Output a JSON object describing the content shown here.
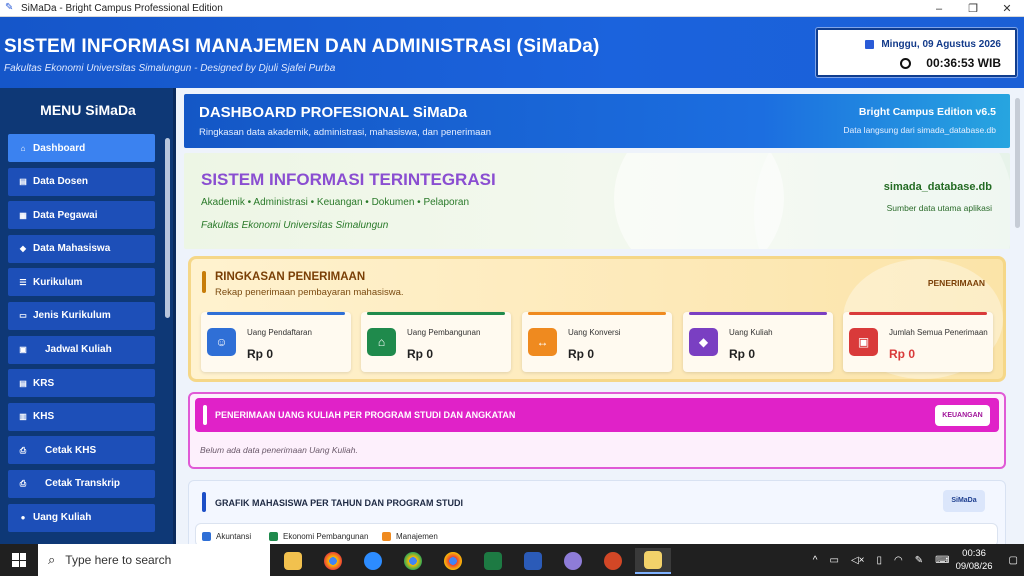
{
  "window": {
    "title": "SiMaDa - Bright Campus Professional Edition",
    "minimize": "–",
    "maximize": "❐",
    "close": "✕"
  },
  "header": {
    "title": "SISTEM INFORMASI MANAJEMEN DAN ADMINISTRASI (SiMaDa)",
    "subtitle": "Fakultas Ekonomi Universitas Simalungun - Designed by Djuli Sjafei Purba",
    "date": "Minggu, 09 Agustus 2026",
    "time": "00:36:53 WIB"
  },
  "sidebar": {
    "title": "MENU SiMaDa",
    "items": [
      {
        "label": "Dashboard",
        "icon": "home-icon",
        "glyph": "⌂"
      },
      {
        "label": "Data Dosen",
        "icon": "book-icon",
        "glyph": "▤"
      },
      {
        "label": "Data Pegawai",
        "icon": "building-icon",
        "glyph": "▦"
      },
      {
        "label": "Data Mahasiswa",
        "icon": "graduation-cap-icon",
        "glyph": "◆"
      },
      {
        "label": "Kurikulum",
        "icon": "list-icon",
        "glyph": "☰"
      },
      {
        "label": "Jenis Kurikulum",
        "icon": "folder-icon",
        "glyph": "▭"
      },
      {
        "label": "Jadwal Kuliah",
        "icon": "calendar-icon",
        "glyph": "▣"
      },
      {
        "label": "KRS",
        "icon": "clipboard-icon",
        "glyph": "▤"
      },
      {
        "label": "KHS",
        "icon": "document-icon",
        "glyph": "▥"
      },
      {
        "label": "Cetak KHS",
        "icon": "printer-icon",
        "glyph": "⎙"
      },
      {
        "label": "Cetak Transkrip",
        "icon": "printer-icon",
        "glyph": "⎙"
      },
      {
        "label": "Uang Kuliah",
        "icon": "money-icon",
        "glyph": "●"
      }
    ]
  },
  "dashboard": {
    "title": "DASHBOARD PROFESIONAL SiMaDa",
    "subtitle": "Ringkasan data akademik, administrasi, mahasiswa, dan penerimaan",
    "edition": "Bright Campus Edition v6.5",
    "source": "Data langsung dari simada_database.db"
  },
  "integrated": {
    "title": "SISTEM INFORMASI TERINTEGRASI",
    "modules": "Akademik • Administrasi • Keuangan • Dokumen • Pelaporan",
    "faculty": "Fakultas Ekonomi Universitas Simalungun",
    "db_name": "simada_database.db",
    "db_caption": "Sumber data utama aplikasi"
  },
  "receipts": {
    "title": "RINGKASAN PENERIMAAN",
    "subtitle": "Rekap penerimaan pembayaran mahasiswa.",
    "tag": "PENERIMAAN",
    "cards": [
      {
        "label": "Uang Pendaftaran",
        "value": "Rp 0",
        "color": "#2f6fd6",
        "icon": "user-icon",
        "glyph": "☺"
      },
      {
        "label": "Uang Pembangunan",
        "value": "Rp 0",
        "color": "#1f8a4c",
        "icon": "building-icon",
        "glyph": "⌂"
      },
      {
        "label": "Uang Konversi",
        "value": "Rp 0",
        "color": "#ef8a1f",
        "icon": "exchange-icon",
        "glyph": "↔"
      },
      {
        "label": "Uang Kuliah",
        "value": "Rp 0",
        "color": "#7a3fc2",
        "icon": "graduation-cap-icon",
        "glyph": "◆"
      },
      {
        "label": "Jumlah Semua Penerimaan",
        "value": "Rp 0",
        "color": "#d93a3a",
        "icon": "wallet-icon",
        "glyph": "▣"
      }
    ]
  },
  "tuition": {
    "title": "PENERIMAAN UANG KULIAH PER PROGRAM STUDI DAN ANGKATAN",
    "button": "KEUANGAN",
    "empty": "Belum ada data penerimaan Uang Kuliah."
  },
  "graph": {
    "title": "GRAFIK MAHASISWA PER TAHUN DAN PROGRAM STUDI",
    "button": "SiMaDa",
    "legend": [
      {
        "label": "Akuntansi",
        "color": "#2f6fd6"
      },
      {
        "label": "Ekonomi Pembangunan",
        "color": "#1f8a4c"
      },
      {
        "label": "Manajemen",
        "color": "#ef8a1f"
      }
    ]
  },
  "taskbar": {
    "search_placeholder": "Type here to search",
    "time": "00:36",
    "date": "09/08/26"
  }
}
